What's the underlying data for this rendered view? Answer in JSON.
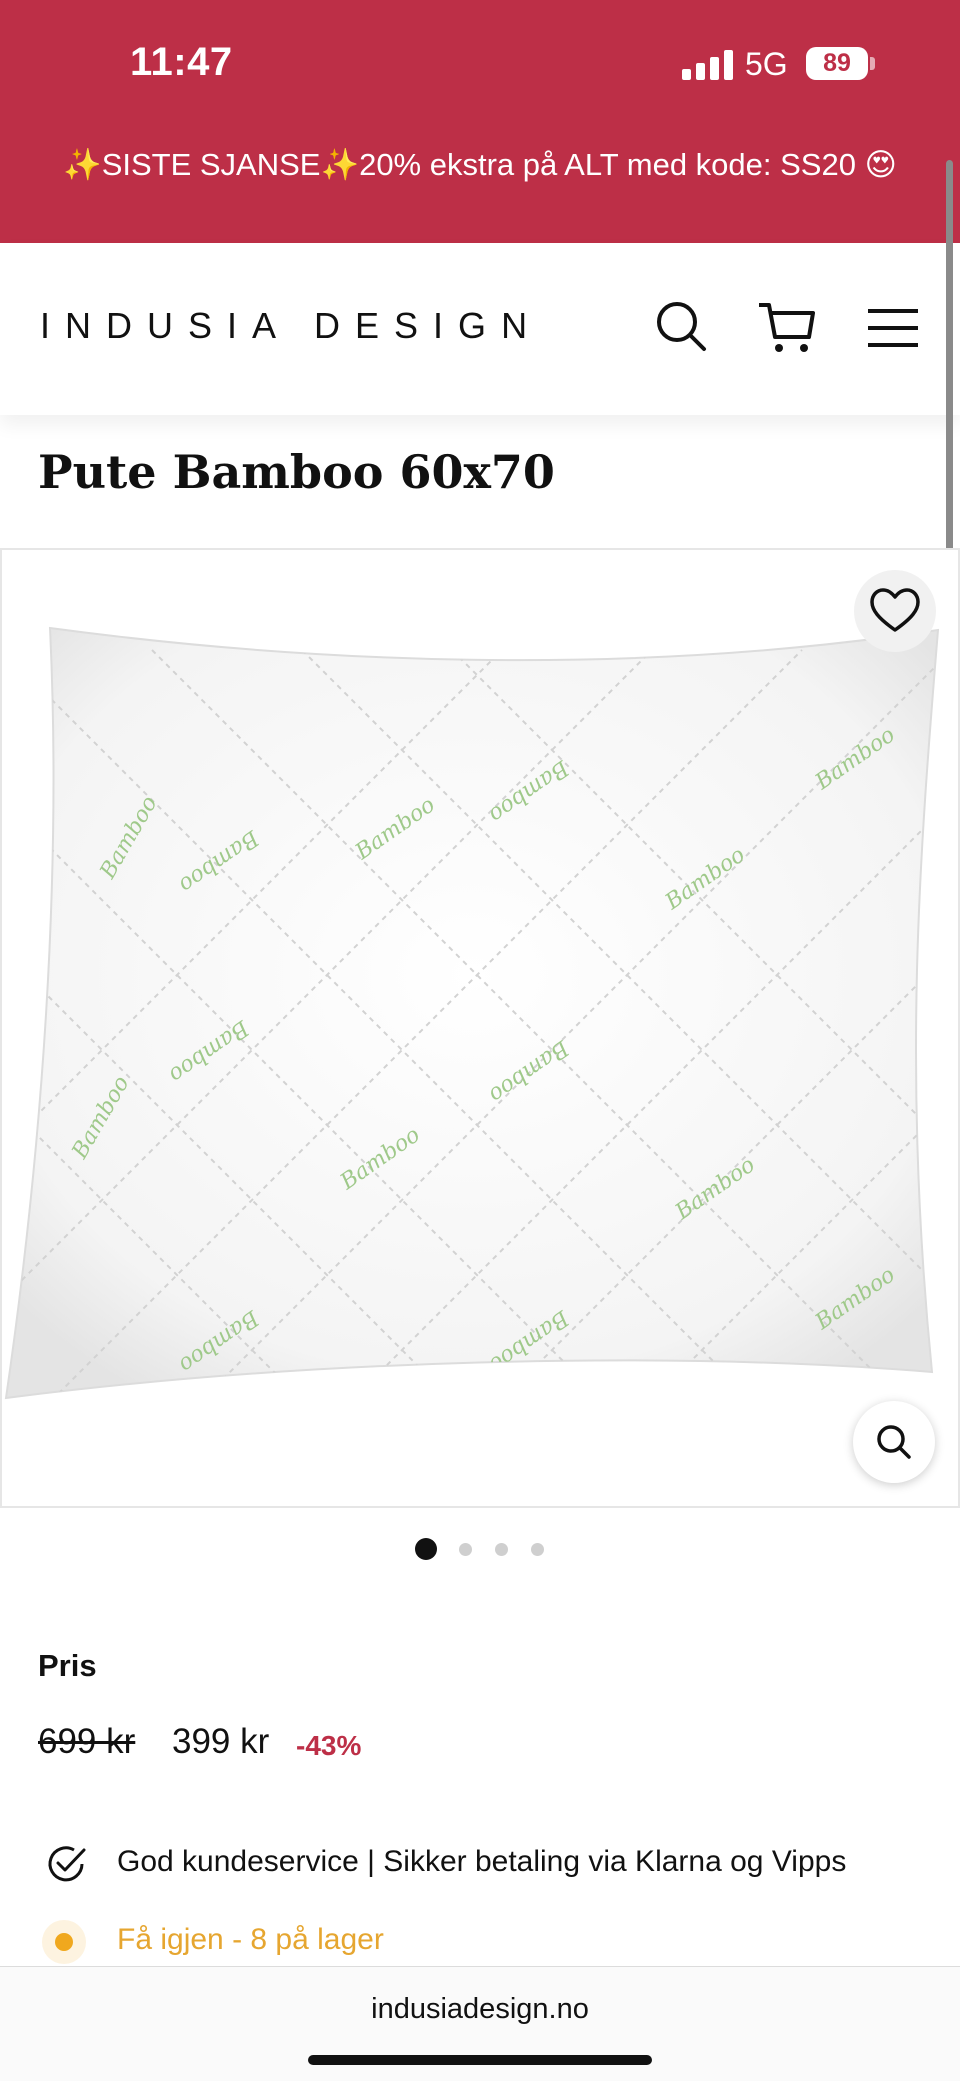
{
  "status_bar": {
    "time": "11:47",
    "network": "5G",
    "battery": "89"
  },
  "promo_banner": {
    "text": "✨SISTE SJANSE✨20% ekstra på ALT med kode: SS20 😍"
  },
  "header": {
    "logo": "INDUSIA DESIGN",
    "icons": [
      "search-icon",
      "cart-icon",
      "menu-icon"
    ]
  },
  "product": {
    "title": "Pute Bamboo 60x70",
    "image_watermark": "Bamboo",
    "carousel": {
      "count": 4,
      "active": 0
    },
    "price_label": "Pris",
    "price_old": "699 kr",
    "price_new": "399 kr",
    "discount": "-43%",
    "usp": "God kundeservice | Sikker betaling via Klarna og Vipps",
    "stock": "Få igjen - 8 på lager"
  },
  "browser": {
    "url": "indusiadesign.no"
  },
  "colors": {
    "brand": "#bd2f47",
    "stock": "#f0a81e"
  }
}
